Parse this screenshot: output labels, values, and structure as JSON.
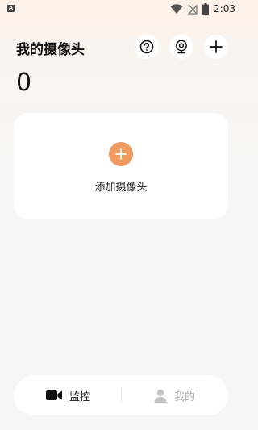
{
  "status_bar": {
    "left_icon_label": "A",
    "time": "2:03"
  },
  "header": {
    "title": "我的摄像头",
    "count": "0",
    "icons": [
      "help-icon",
      "camera-device-icon",
      "plus-icon"
    ]
  },
  "add_card": {
    "label": "添加摄像头",
    "accent_color": "#f09a5f"
  },
  "bottom_nav": {
    "items": [
      {
        "label": "监控",
        "icon": "video-camera-icon",
        "active": true
      },
      {
        "label": "我的",
        "icon": "person-icon",
        "active": false
      }
    ]
  }
}
